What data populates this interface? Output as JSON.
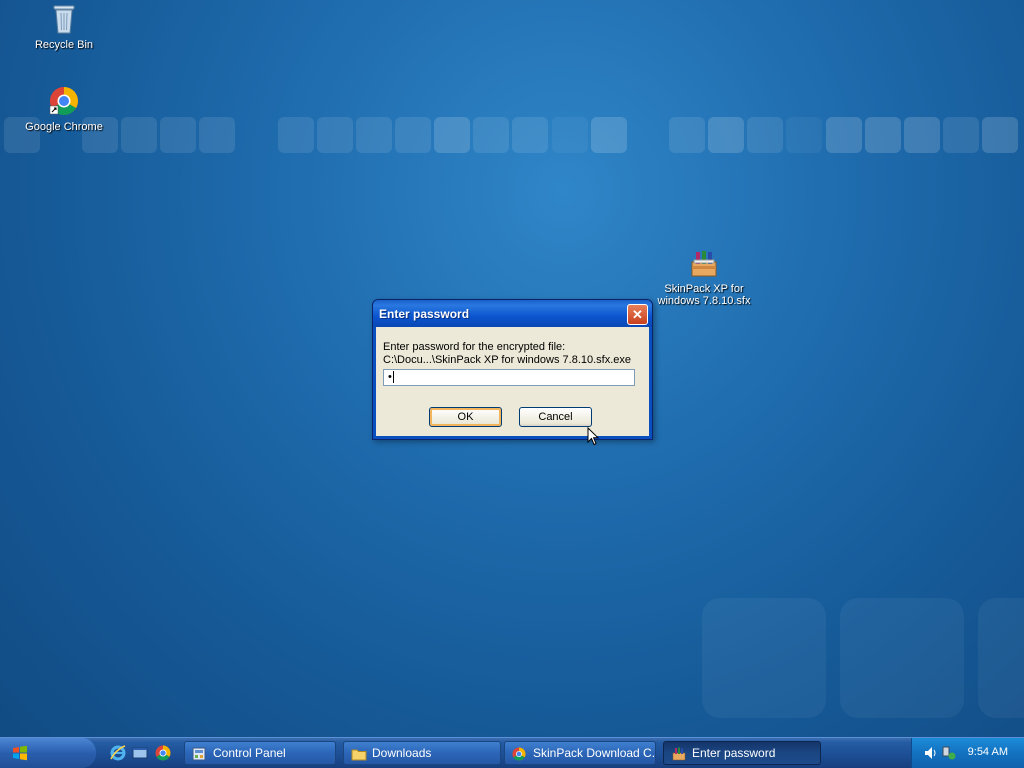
{
  "desktop": {
    "icons": [
      {
        "label": "Recycle Bin",
        "icon": "recycle-bin-icon"
      },
      {
        "label": "Google Chrome",
        "icon": "chrome-icon"
      },
      {
        "label": "SkinPack XP for windows 7.8.10.sfx",
        "icon": "winrar-sfx-icon"
      }
    ]
  },
  "dialog": {
    "title": "Enter password",
    "close_label": "✕",
    "prompt_line1": "Enter password for the encrypted file:",
    "prompt_line2": "C:\\Docu...\\SkinPack XP for windows 7.8.10.sfx.exe",
    "password_value": "•",
    "ok_label": "OK",
    "cancel_label": "Cancel"
  },
  "taskbar": {
    "quick_launch": [
      "ie-icon",
      "show-desktop-icon",
      "chrome-icon"
    ],
    "tasks": [
      {
        "label": "Control Panel",
        "icon": "control-panel-icon",
        "active": false
      },
      {
        "label": "Downloads",
        "icon": "folder-icon",
        "active": false
      },
      {
        "label": "SkinPack Download C...",
        "icon": "chrome-icon",
        "active": false
      },
      {
        "label": "Enter password",
        "icon": "winrar-icon",
        "active": true
      }
    ],
    "tray": {
      "icons": [
        "volume-icon",
        "network-icon"
      ],
      "clock": "9:54 AM"
    }
  },
  "colors": {
    "accent": "#0a4fc0",
    "desktop": "#1f6cae",
    "taskbar": "#245ca3"
  }
}
